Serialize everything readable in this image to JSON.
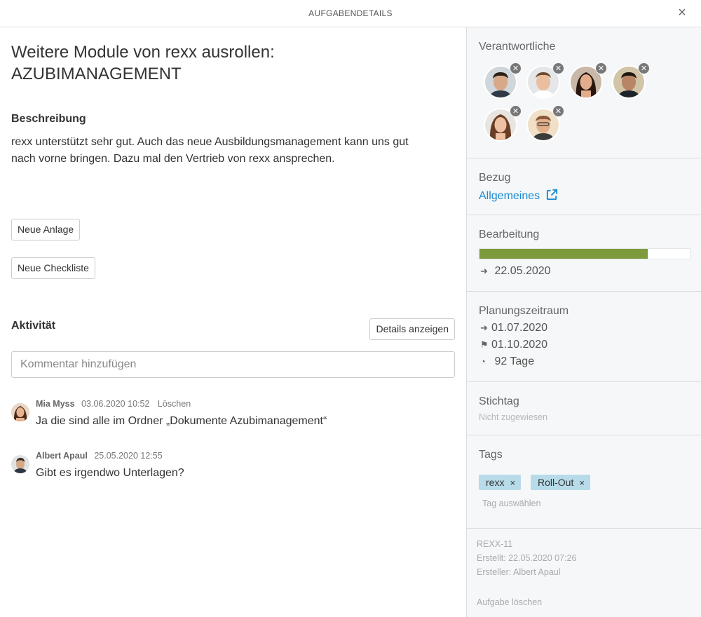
{
  "header": {
    "title": "AUFGABENDETAILS",
    "close_icon": "×"
  },
  "task": {
    "title_line1": "Weitere Module von rexx ausrollen:",
    "title_line2": "AZUBIMANAGEMENT",
    "description_label": "Beschreibung",
    "description_line1": "rexx unterstützt sehr gut. Auch das neue Ausbildungsmanagement kann uns gut",
    "description_line2": "nach vorne bringen. Dazu mal den Vertrieb von rexx ansprechen.",
    "new_attachment_label": "Neue Anlage",
    "new_checklist_label": "Neue Checkliste"
  },
  "activity": {
    "label": "Aktivität",
    "details_button": "Details anzeigen",
    "comment_placeholder": "Kommentar hinzufügen",
    "comments": [
      {
        "author": "Mia Myss",
        "date": "03.06.2020 10:52",
        "delete_label": "Löschen",
        "text": "Ja die sind alle im Ordner „Dokumente Azubimanagement“"
      },
      {
        "author": "Albert Apaul",
        "date": "25.05.2020 12:55",
        "text": "Gibt es irgendwo Unterlagen?"
      }
    ]
  },
  "sidebar": {
    "responsible": {
      "label": "Verantwortliche",
      "avatar_count": 6
    },
    "reference": {
      "label": "Bezug",
      "link": "Allgemeines"
    },
    "processing": {
      "label": "Bearbeitung",
      "progress_fraction": 0.8,
      "date": "22.05.2020"
    },
    "planning": {
      "label": "Planungszeitraum",
      "start": "01.07.2020",
      "end": "01.10.2020",
      "duration": "92 Tage"
    },
    "deadline": {
      "label": "Stichtag",
      "value": "Nicht zugewiesen"
    },
    "tags": {
      "label": "Tags",
      "items": [
        "rexx",
        "Roll-Out"
      ],
      "remove_glyph": "×",
      "select_placeholder": "Tag auswählen"
    },
    "meta": {
      "key": "REXX-11",
      "created": "Erstellt: 22.05.2020 07:26",
      "creator": "Ersteller: Albert Apaul",
      "delete_task": "Aufgabe löschen"
    }
  },
  "colors": {
    "progress": "#7d9a3c",
    "link": "#1a8bd1",
    "tag_bg": "#b7dbe9",
    "sidebar_bg": "#f5f7f8"
  }
}
